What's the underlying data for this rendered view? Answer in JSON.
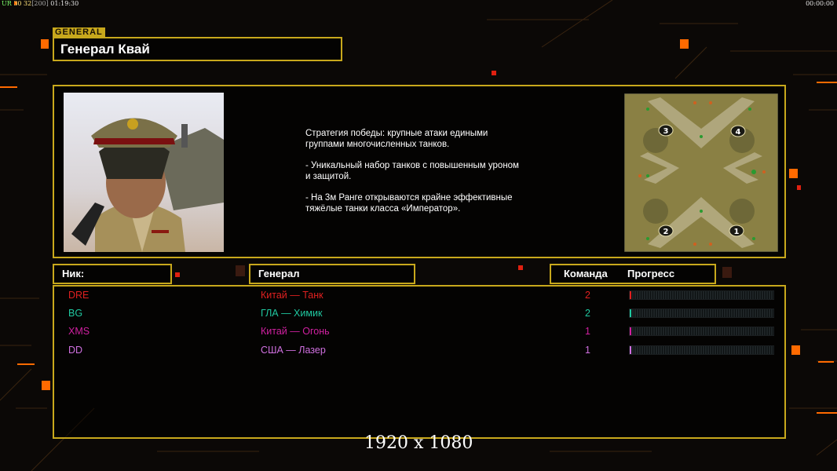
{
  "hud": {
    "top_left_prefix": "ÜR",
    "top_left_fps": "30",
    "top_left_limit": "32",
    "top_left_max": "[200]",
    "top_left_time": "01:19:30",
    "top_right_time": "00:00:00"
  },
  "general": {
    "tag": "GENERAL",
    "name": "Генерал Квай",
    "portrait_icon": "general-kwai-portrait",
    "strategy": [
      "Стратегия победы: крупные атаки едиными\n группами многочисленных танков.",
      "- Уникальный набор танков с повышенным уроном\n и защитой.",
      "- На 3м Ранге открываются крайне эффективные\n тяжёлые танки класса «Император»."
    ]
  },
  "map": {
    "icon": "minimap-preview",
    "start_positions": [
      "1",
      "2",
      "3",
      "4"
    ]
  },
  "table": {
    "headers": {
      "nick": "Ник:",
      "general": "Генерал",
      "team": "Команда",
      "progress": "Прогресс"
    },
    "rows": [
      {
        "nick": "DRE",
        "general": "Китай — Танк",
        "team": "2",
        "color": "#e02020",
        "progress": 0.01
      },
      {
        "nick": "BG",
        "general": "ГЛА — Химик",
        "team": "2",
        "color": "#20c8a0",
        "progress": 0.01
      },
      {
        "nick": "XMS",
        "general": "Китай — Огонь",
        "team": "1",
        "color": "#d020a0",
        "progress": 0.005
      },
      {
        "nick": "DD",
        "general": "США — Лазер",
        "team": "1",
        "color": "#d070e0",
        "progress": 0.005
      }
    ]
  },
  "resolution_label": "1920 x 1080",
  "colors": {
    "frame": "#c8a81c",
    "accent_orange": "#ff6a00",
    "accent_red": "#e02010"
  }
}
